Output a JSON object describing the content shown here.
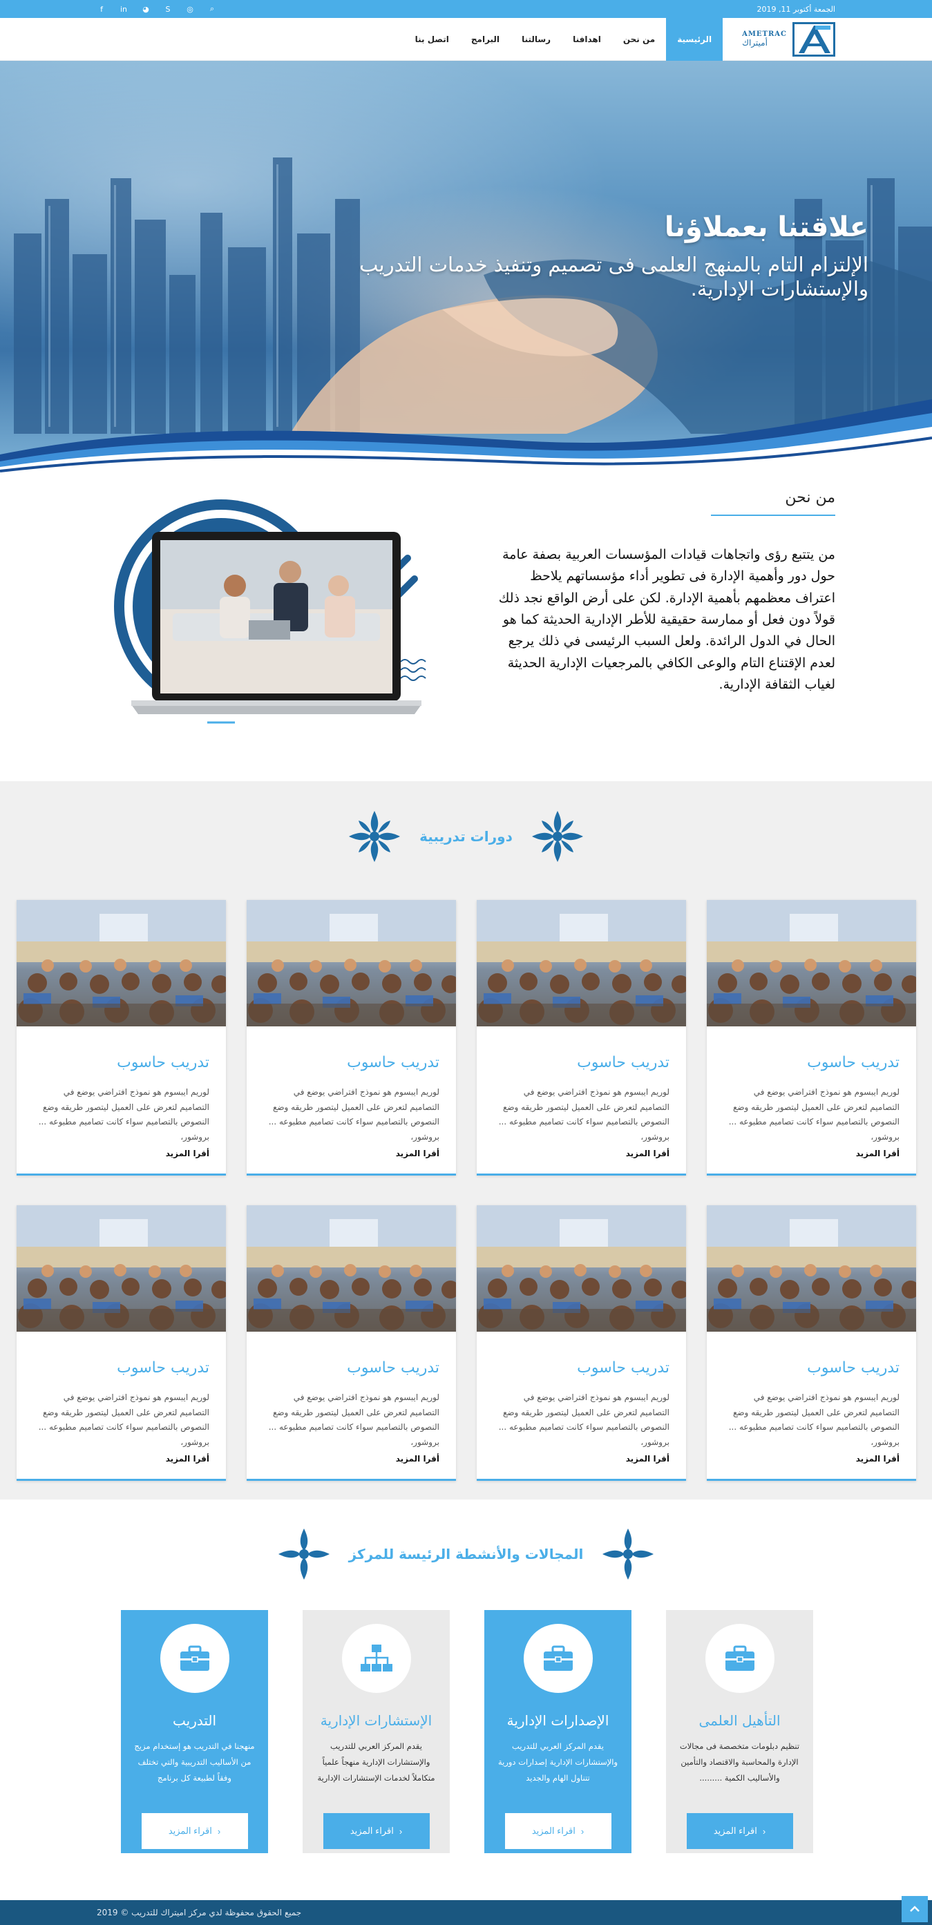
{
  "topbar": {
    "date": "الجمعة أكتوبر 11, 2019",
    "social_icons": [
      "facebook-icon",
      "linkedin-icon",
      "rss-icon",
      "skype-icon",
      "instagram-icon",
      "search-icon"
    ],
    "social_glyphs": [
      "f",
      "in",
      "◕",
      "S",
      "◎",
      "⌕"
    ]
  },
  "header": {
    "logo_en": "AMETRAC",
    "logo_ar": "أميتراك",
    "nav": [
      "الرئيسية",
      "من نحن",
      "اهدافنا",
      "رسالتنا",
      "البرامج",
      "اتصل بنا"
    ]
  },
  "hero": {
    "title": "علاقتنا بعملاؤنا",
    "subtitle": "الإلتزام التام بالمنهج العلمى فى تصميم وتنفيذ خدمات التدريب والإستشارات الإدارية."
  },
  "about": {
    "title": "من نحن",
    "text": "من يتتبع رؤى واتجاهات قيادات المؤسسات العربية بصفة عامة حول دور وأهمية الإدارة فى تطوير أداء مؤسساتهم يلاحظ اعتراف معظمهم بأهمية الإدارة. لكن على أرض الواقع نجد ذلك قولاً دون  فعل أو ممارسة حقيقية للأطر الإدارية الحديثة كما هو الحال في الدول الرائدة. ولعل السبب الرئيسى في ذلك يرجع لعدم الإقتناع التام والوعى الكافي بالمرجعيات الإدارية الحديثة لغياب الثقافة الإدارية."
  },
  "courses": {
    "title": "دورات تدريبية",
    "items": [
      {
        "title": "تدريب حاسوب",
        "text": "لوريم ايبسوم هو نموذج افتراضي يوضع في التصاميم لتعرض على العميل ليتصور طريقه وضع النصوص بالتصاميم سواء كانت تصاميم مطبوعه ... بروشور،",
        "more": "أقرا المزيد"
      },
      {
        "title": "تدريب حاسوب",
        "text": "لوريم ايبسوم هو نموذج افتراضي يوضع في التصاميم لتعرض على العميل ليتصور طريقه وضع النصوص بالتصاميم سواء كانت تصاميم مطبوعه ... بروشور،",
        "more": "أقرا المزيد"
      },
      {
        "title": "تدريب حاسوب",
        "text": "لوريم ايبسوم هو نموذج افتراضي يوضع في التصاميم لتعرض على العميل ليتصور طريقه وضع النصوص بالتصاميم سواء كانت تصاميم مطبوعه ... بروشور،",
        "more": "أقرا المزيد"
      },
      {
        "title": "تدريب حاسوب",
        "text": "لوريم ايبسوم هو نموذج افتراضي يوضع في التصاميم لتعرض على العميل ليتصور طريقه وضع النصوص بالتصاميم سواء كانت تصاميم مطبوعه ... بروشور،",
        "more": "أقرا المزيد"
      },
      {
        "title": "تدريب حاسوب",
        "text": "لوريم ايبسوم هو نموذج افتراضي يوضع في التصاميم لتعرض على العميل ليتصور طريقه وضع النصوص بالتصاميم سواء كانت تصاميم مطبوعه ... بروشور،",
        "more": "أقرا المزيد"
      },
      {
        "title": "تدريب حاسوب",
        "text": "لوريم ايبسوم هو نموذج افتراضي يوضع في التصاميم لتعرض على العميل ليتصور طريقه وضع النصوص بالتصاميم سواء كانت تصاميم مطبوعه ... بروشور،",
        "more": "أقرا المزيد"
      },
      {
        "title": "تدريب حاسوب",
        "text": "لوريم ايبسوم هو نموذج افتراضي يوضع في التصاميم لتعرض على العميل ليتصور طريقه وضع النصوص بالتصاميم سواء كانت تصاميم مطبوعه ... بروشور،",
        "more": "أقرا المزيد"
      },
      {
        "title": "تدريب حاسوب",
        "text": "لوريم ايبسوم هو نموذج افتراضي يوضع في التصاميم لتعرض على العميل ليتصور طريقه وضع النصوص بالتصاميم سواء كانت تصاميم مطبوعه ... بروشور،",
        "more": "أقرا المزيد"
      }
    ]
  },
  "fields": {
    "title": "المجالات والأنشطة الرئيسة للمركز",
    "items": [
      {
        "title": "التدريب",
        "text": "منهجنا في التدريب هو إستخدام مزيج من الأساليب التدريبية والتي تختلف وفقاً لطبيعة كل برنامج",
        "button": "اقراء المزيد",
        "style": "blue",
        "icon": "briefcase-icon"
      },
      {
        "title": "الإستشارات الإدارية",
        "text": "يقدم المركز العربي للتدريب والإستشارات الإدارية منهجاً علمياً متكاملاً لخدمات الإستشارات الإدارية",
        "button": "اقراء المزيد",
        "style": "gray",
        "icon": "org-chart-icon"
      },
      {
        "title": "الإصدارات الإدارية",
        "text": "يقدم المركز العربي للتدريب والإستشارات الإدارية إصدارات دورية تتناول الهام والجديد",
        "button": "اقراء المزيد",
        "style": "blue",
        "icon": "briefcase-icon"
      },
      {
        "title": "التأهيل العلمى",
        "text": "تنظيم دبلومات متخصصة فى مجالات الإدارة والمحاسبة والاقتصاد والتأمين والأساليب الكمية .........",
        "button": "اقراء المزيد",
        "style": "gray",
        "icon": "briefcase-icon"
      }
    ]
  },
  "footer": {
    "copyright": "جميع الحقوق محفوظة لدي مركز اميتراك للتدريب © 2019"
  },
  "colors": {
    "accent": "#4aaee8",
    "footer": "#1a5780",
    "ornament": "#1f6fa8"
  }
}
